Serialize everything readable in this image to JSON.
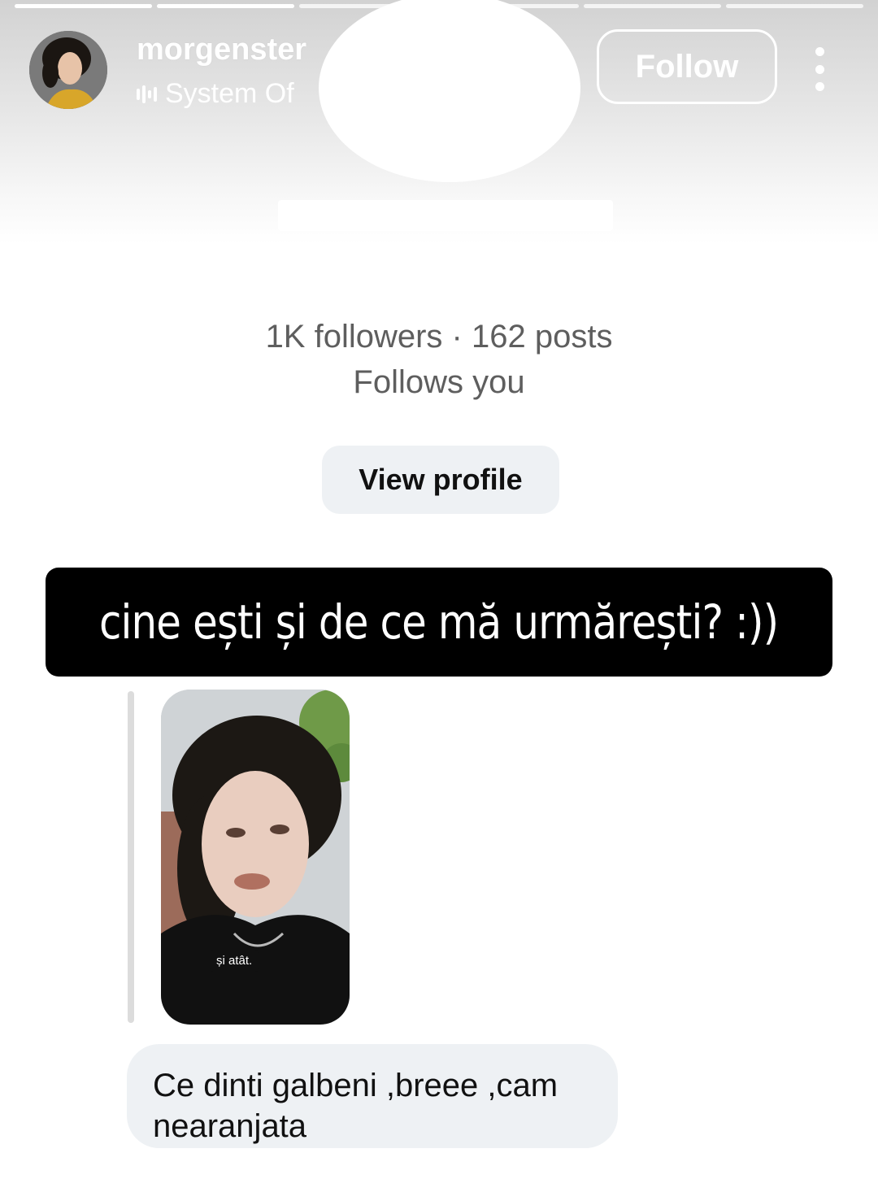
{
  "header": {
    "username": "morgenster",
    "music_text": "System Of",
    "follow_label": "Follow",
    "progress_segments": 6,
    "icons": {
      "avatar": "avatar",
      "music": "sound-bars-icon",
      "more": "more-vertical-icon"
    }
  },
  "profile_card": {
    "stats_line": "1K followers · 162 posts",
    "follows_you": "Follows you",
    "view_profile_label": "View profile"
  },
  "caption": {
    "text": "cine ești și de ce mă urmărești? :))"
  },
  "reply": {
    "story_subtitle": "și atât.",
    "message": "Ce dinti galbeni ,breee ,cam nearanjata"
  },
  "colors": {
    "bubble_bg": "#eef1f4",
    "caption_bg": "#000000",
    "text_gray": "#5e5e5e"
  }
}
